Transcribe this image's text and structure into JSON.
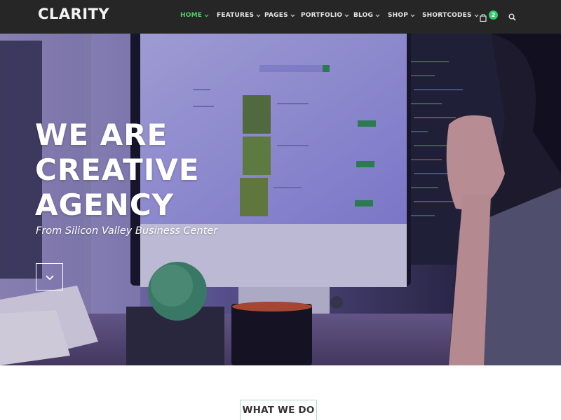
{
  "header": {
    "logo": "CLARITY",
    "nav": [
      {
        "label": "HOME",
        "active": true
      },
      {
        "label": "FEATURES",
        "active": false
      },
      {
        "label": "PAGES",
        "active": false
      },
      {
        "label": "PORTFOLIO",
        "active": false
      },
      {
        "label": "BLOG",
        "active": false
      },
      {
        "label": "SHOP",
        "active": false
      },
      {
        "label": "SHORTCODES",
        "active": false
      }
    ],
    "cart_count": "2",
    "icons": {
      "cart": "shopping-bag-icon",
      "search": "search-icon",
      "dropdown": "chevron-down-icon"
    }
  },
  "hero": {
    "heading_lines": [
      "WE ARE",
      "CREATIVE",
      "AGENCY"
    ],
    "subheading": "From Silicon Valley Business Center",
    "scroll_icon": "chevron-down-icon"
  },
  "section": {
    "title": "WHAT WE DO"
  },
  "colors": {
    "header_bg": "#262626",
    "accent": "#4fce6e",
    "badge": "#2ecc71",
    "hero_tint": "#4a44a8"
  }
}
